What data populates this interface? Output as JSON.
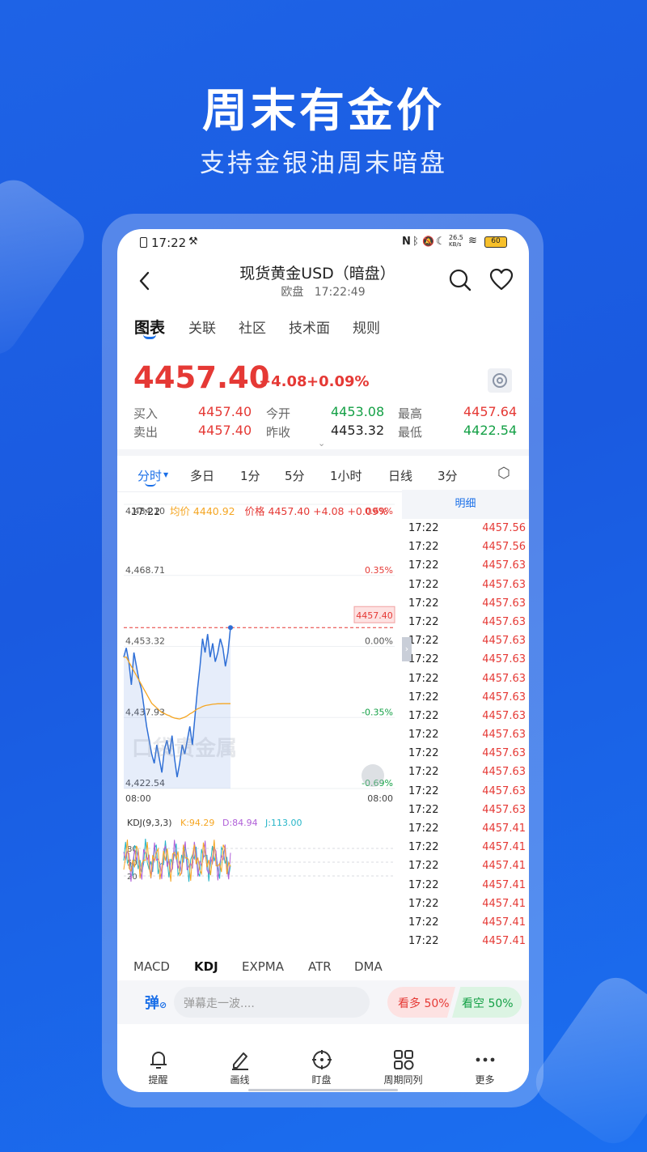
{
  "promo": {
    "headline": "周末有金价",
    "subline": "支持金银油周末暗盘"
  },
  "status_bar": {
    "time": "17:22",
    "net_speed": "26.5",
    "net_unit": "KB/s",
    "battery": "60"
  },
  "header": {
    "title": "现货黄金USD（暗盘）",
    "session": "欧盘",
    "time": "17:22:49"
  },
  "tabs": [
    "图表",
    "关联",
    "社区",
    "技术面",
    "规则"
  ],
  "quote": {
    "price": "4457.40",
    "change": "+4.08",
    "change_pct": "+0.09%",
    "buy_label": "买入",
    "buy": "4457.40",
    "sell_label": "卖出",
    "sell": "4457.40",
    "open_label": "今开",
    "open": "4453.08",
    "prev_label": "昨收",
    "prev": "4453.32",
    "high_label": "最高",
    "high": "4457.64",
    "low_label": "最低",
    "low": "4422.54"
  },
  "periods": [
    "分时",
    "多日",
    "1分",
    "5分",
    "1小时",
    "日线",
    "3分"
  ],
  "chart_info": {
    "time": "17:22",
    "avg_label": "均价 4440.92",
    "price_label": "价格 4457.40 +4.08 +0.09%"
  },
  "chart_data": {
    "type": "line",
    "y_ticks": [
      "4,484.10",
      "4,468.71",
      "4,453.32",
      "4,437.93",
      "4,422.54"
    ],
    "y_ticks_right": [
      "0.69%",
      "0.35%",
      "0.00%",
      "-0.35%",
      "-0.69%"
    ],
    "x_ticks": [
      "08:00",
      "08:00"
    ],
    "current_price_tag": "4457.40",
    "ylim": [
      4422.54,
      4484.1
    ],
    "series": [
      {
        "values": [
          4451,
          4453,
          4450,
          4445,
          4452,
          4449,
          4446,
          4444,
          4440,
          4436,
          4433,
          4430,
          4428,
          4432,
          4429,
          4426,
          4431,
          4433,
          4430,
          4434,
          4429,
          4425,
          4428,
          4432,
          4430,
          4433,
          4436,
          4432,
          4438,
          4444,
          4449,
          4455,
          4452,
          4456,
          4451,
          4454,
          4450,
          4452,
          4455,
          4453,
          4449,
          4452,
          4457.4
        ],
        "color": "#2f6fd6"
      },
      {
        "values": [
          4451,
          4451,
          4450,
          4449,
          4448,
          4447,
          4446,
          4445,
          4444,
          4443,
          4442,
          4441,
          4440.5,
          4440,
          4439.5,
          4439,
          4438.8,
          4438.5,
          4438.3,
          4438,
          4437.8,
          4437.7,
          4437.6,
          4437.8,
          4438,
          4438.3,
          4438.7,
          4439,
          4439.4,
          4439.8,
          4440,
          4440.3,
          4440.5,
          4440.6,
          4440.7,
          4440.8,
          4440.85,
          4440.9,
          4440.9,
          4440.92,
          4440.92,
          4440.92,
          4440.92
        ],
        "color": "#f5a623"
      }
    ],
    "kdj": {
      "label": "KDJ(9,3,3)",
      "k": "K:94.29",
      "d": "D:84.94",
      "j": "J:113.00",
      "levels": [
        "80",
        "50",
        "20"
      ]
    }
  },
  "watermark": "口袋贵金属",
  "ticks": {
    "header": "明细",
    "rows": [
      {
        "t": "17:22",
        "p": "4457.56"
      },
      {
        "t": "17:22",
        "p": "4457.56"
      },
      {
        "t": "17:22",
        "p": "4457.63"
      },
      {
        "t": "17:22",
        "p": "4457.63"
      },
      {
        "t": "17:22",
        "p": "4457.63"
      },
      {
        "t": "17:22",
        "p": "4457.63"
      },
      {
        "t": "17:22",
        "p": "4457.63"
      },
      {
        "t": "17:22",
        "p": "4457.63"
      },
      {
        "t": "17:22",
        "p": "4457.63"
      },
      {
        "t": "17:22",
        "p": "4457.63"
      },
      {
        "t": "17:22",
        "p": "4457.63"
      },
      {
        "t": "17:22",
        "p": "4457.63"
      },
      {
        "t": "17:22",
        "p": "4457.63"
      },
      {
        "t": "17:22",
        "p": "4457.63"
      },
      {
        "t": "17:22",
        "p": "4457.63"
      },
      {
        "t": "17:22",
        "p": "4457.63"
      },
      {
        "t": "17:22",
        "p": "4457.41"
      },
      {
        "t": "17:22",
        "p": "4457.41"
      },
      {
        "t": "17:22",
        "p": "4457.41"
      },
      {
        "t": "17:22",
        "p": "4457.41"
      },
      {
        "t": "17:22",
        "p": "4457.41"
      },
      {
        "t": "17:22",
        "p": "4457.41"
      },
      {
        "t": "17:22",
        "p": "4457.41"
      }
    ]
  },
  "indicators": [
    "MACD",
    "KDJ",
    "EXPMA",
    "ATR",
    "DMA"
  ],
  "danmaku": {
    "icon_label": "弹",
    "placeholder": "弹幕走一波....",
    "bull": "看多 50%",
    "bear": "看空 50%"
  },
  "nav": [
    "提醒",
    "画线",
    "盯盘",
    "周期同列",
    "更多"
  ],
  "colors": {
    "up": "#e53935",
    "down": "#14a046",
    "accent": "#1a6fe8"
  }
}
